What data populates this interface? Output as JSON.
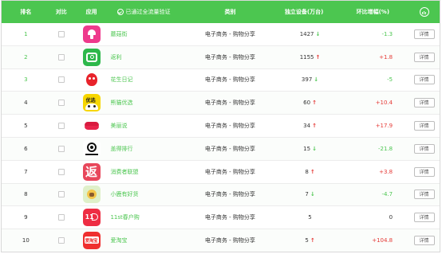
{
  "header": {
    "rank": "排名",
    "compare": "对比",
    "app": "应用",
    "verified": "已通过全流量验证",
    "category": "类别",
    "devices": "独立设备(万台)",
    "change": "环比增幅(%)"
  },
  "colors": {
    "accent": "#4cc650",
    "up": "#e53935",
    "down": "#4cc650"
  },
  "rows": [
    {
      "rank": "1",
      "name": "蘑菇街",
      "category": "电子商务 - 购物分享",
      "devices": "1427",
      "trend": "down",
      "change": "-1.3",
      "action": "详情",
      "icon": "mogujie-logo-icon"
    },
    {
      "rank": "2",
      "name": "返利",
      "category": "电子商务 - 购物分享",
      "devices": "1155",
      "trend": "up",
      "change": "+1.8",
      "action": "详情",
      "icon": "fanli-logo-icon"
    },
    {
      "rank": "3",
      "name": "花生日记",
      "category": "电子商务 - 购物分享",
      "devices": "397",
      "trend": "down",
      "change": "-5",
      "action": "详情",
      "icon": "huasheng-logo-icon"
    },
    {
      "rank": "4",
      "name": "熊猫优选",
      "category": "电子商务 - 购物分享",
      "devices": "60",
      "trend": "up",
      "change": "+10.4",
      "action": "详情",
      "icon": "panda-logo-icon"
    },
    {
      "rank": "5",
      "name": "美丽说",
      "category": "电子商务 - 购物分享",
      "devices": "34",
      "trend": "up",
      "change": "+17.9",
      "action": "详情",
      "icon": "lips-logo-icon"
    },
    {
      "rank": "6",
      "name": "盖得排行",
      "category": "电子商务 - 购物分享",
      "devices": "15",
      "trend": "down",
      "change": "-21.8",
      "action": "详情",
      "icon": "gaide-logo-icon"
    },
    {
      "rank": "7",
      "name": "消费者联盟",
      "category": "电子商务 - 购物分享",
      "devices": "8",
      "trend": "up",
      "change": "+3.8",
      "action": "详情",
      "icon": "xiaofeizhe-logo-icon"
    },
    {
      "rank": "8",
      "name": "小鹿有好货",
      "category": "电子商务 - 购物分享",
      "devices": "7",
      "trend": "down",
      "change": "-4.7",
      "action": "详情",
      "icon": "deer-logo-icon"
    },
    {
      "rank": "9",
      "name": "11st春户购",
      "category": "电子商务 - 购物分享",
      "devices": "5",
      "trend": "none",
      "change": "0",
      "action": "详情",
      "icon": "11st-logo-icon"
    },
    {
      "rank": "10",
      "name": "爱淘宝",
      "category": "电子商务 - 购物分享",
      "devices": "5",
      "trend": "up",
      "change": "+104.8",
      "action": "详情",
      "icon": "aitaobao-logo-icon"
    }
  ]
}
